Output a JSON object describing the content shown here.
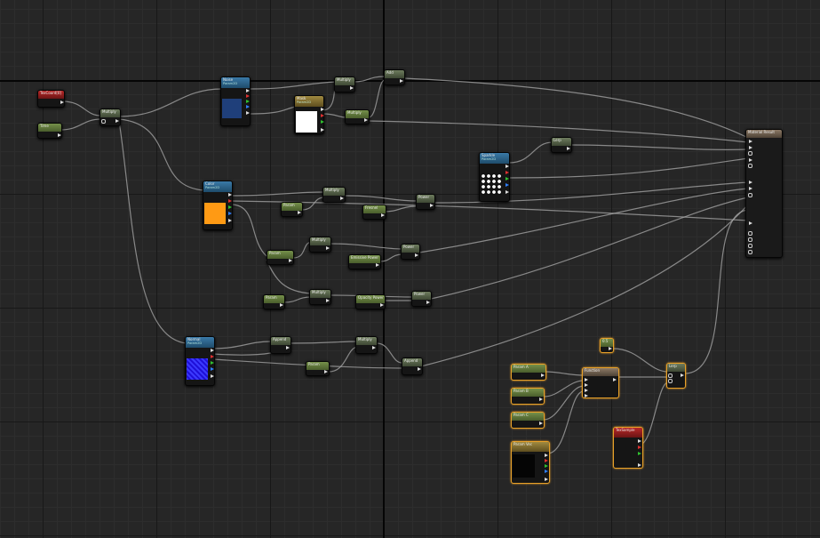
{
  "graph": {
    "watermark": "",
    "nodes": {
      "texcoord": {
        "title": "TexCoord[0]"
      },
      "time": {
        "title": "Time"
      },
      "multiply_a": {
        "title": "Multiply"
      },
      "noise_tex": {
        "title": "Noise",
        "sub": "Param2D"
      },
      "mask_tex": {
        "title": "Mask",
        "sub": "Param2D"
      },
      "multiply_b": {
        "title": "Multiply"
      },
      "add_a": {
        "title": "Add"
      },
      "multiply_c": {
        "title": "Multiply"
      },
      "sparkle_tex": {
        "title": "Sparkle",
        "sub": "Param2D"
      },
      "lerp_a": {
        "title": "Lerp"
      },
      "color_tex": {
        "title": "Color",
        "sub": "Param2D"
      },
      "param_a": {
        "title": "Param"
      },
      "multiply_d": {
        "title": "Multiply"
      },
      "fresnel_a": {
        "title": "Fresnel"
      },
      "power_a": {
        "title": "Power"
      },
      "param_b": {
        "title": "Param"
      },
      "multiply_e": {
        "title": "Multiply"
      },
      "emissive_power": {
        "title": "Emissive Power"
      },
      "power_b": {
        "title": "Power"
      },
      "param_c": {
        "title": "Param"
      },
      "multiply_f": {
        "title": "Multiply"
      },
      "opacity_power": {
        "title": "Opacity Power"
      },
      "power_c": {
        "title": "Power"
      },
      "normal_tex": {
        "title": "Normal",
        "sub": "Param2D"
      },
      "append_a": {
        "title": "Append"
      },
      "multiply_g": {
        "title": "Multiply"
      },
      "param_d": {
        "title": "Param"
      },
      "append_b": {
        "title": "Append"
      },
      "const_a": {
        "title": "0.5"
      },
      "scalar_a": {
        "title": "Param A"
      },
      "scalar_b": {
        "title": "Param B"
      },
      "scalar_c": {
        "title": "Param C"
      },
      "vector_param": {
        "title": "Param Vec"
      },
      "fn_group": {
        "title": "Function"
      },
      "lerp_b": {
        "title": "Lerp"
      },
      "tex_sample": {
        "title": "TexSample"
      },
      "material_result": {
        "title": "Material Result"
      }
    }
  }
}
